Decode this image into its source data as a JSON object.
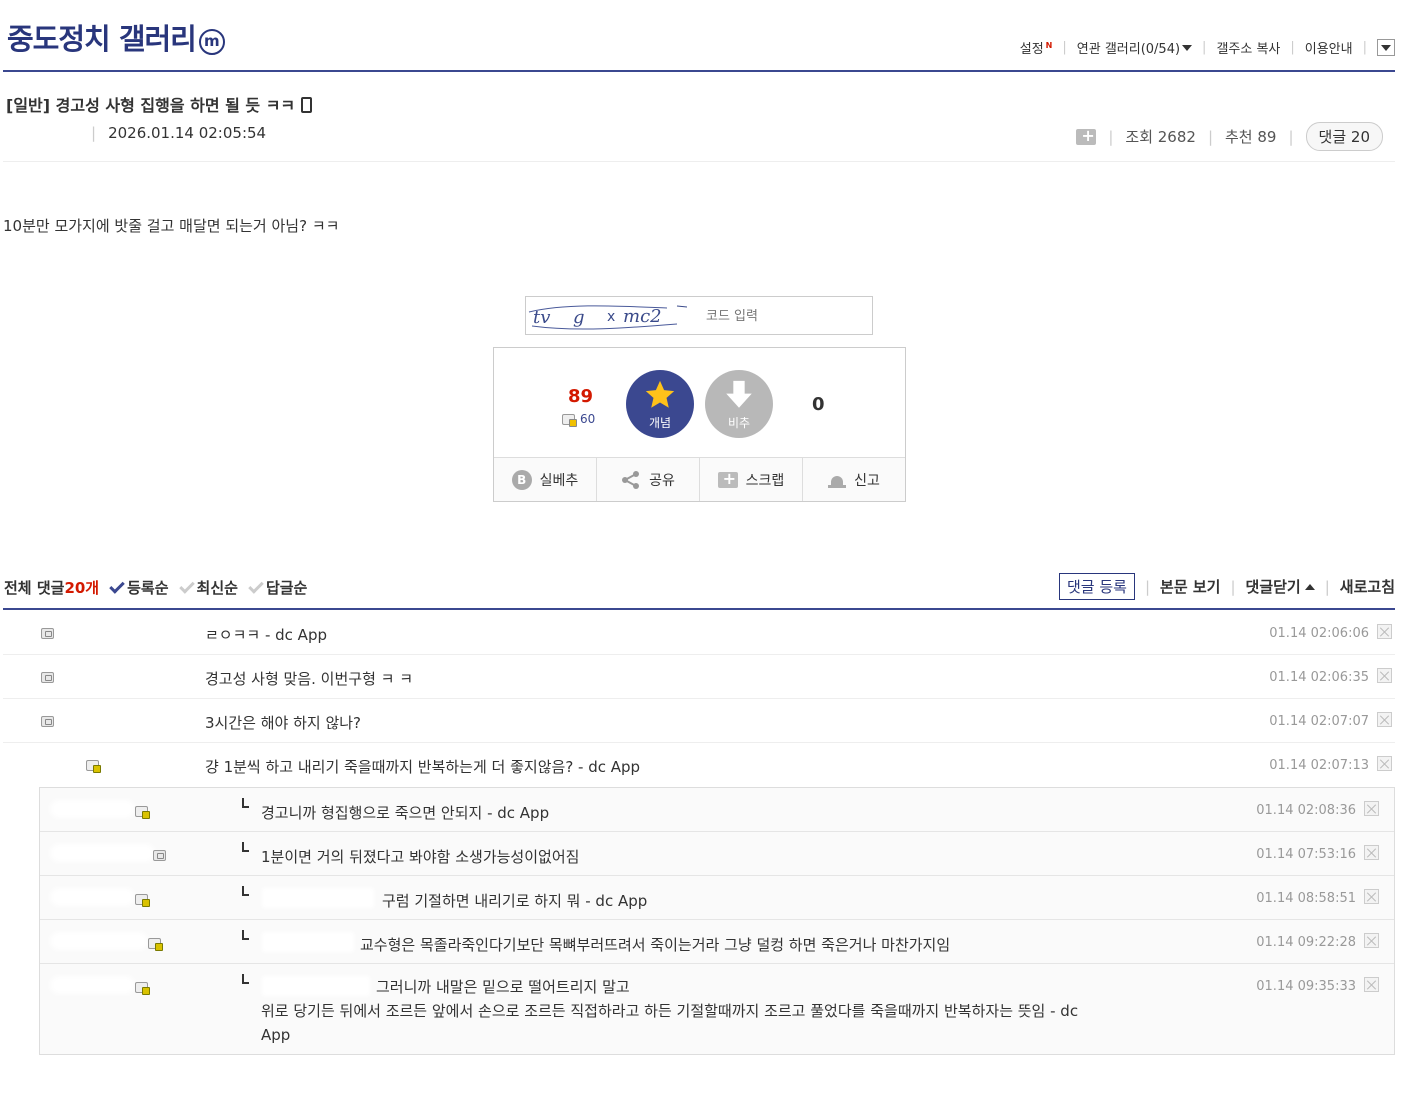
{
  "header": {
    "gallery_title": "중도정치 갤러리",
    "badge": "m",
    "menu": {
      "settings": "설정",
      "settings_new": "N",
      "related": "연관 갤러리(0/54)",
      "copy_addr": "갤주소 복사",
      "guide": "이용안내"
    }
  },
  "post": {
    "title": "[일반] 경고성 사형 집행을 하면 될 듯 ㅋㅋ",
    "date": "2026.01.14 02:05:54",
    "views_label": "조회 2682",
    "recommend_label": "추천 89",
    "comments_label": "댓글 20",
    "body": "10분만 모가지에 밧줄 걸고 매달면 되는거 아님? ㅋㅋ"
  },
  "captcha": {
    "placeholder": "코드 입력"
  },
  "vote": {
    "up_count": "89",
    "fixed_count": "60",
    "up_label": "개념",
    "down_label": "비추",
    "down_count": "0",
    "actions": {
      "best": "실베추",
      "share": "공유",
      "scrap": "스크랩",
      "report": "신고"
    }
  },
  "comments_bar": {
    "all_prefix": "전체 댓글 ",
    "count": "20개",
    "sort_reg": "등록순",
    "sort_new": "최신순",
    "sort_reply": "답글순",
    "register": "댓글 등록",
    "view_body": "본문 보기",
    "close": "댓글닫기",
    "refresh": "새로고침"
  },
  "comments": [
    {
      "text": "ㄹㅇㅋㅋ - dc App",
      "time": "01.14 02:06:06"
    },
    {
      "text": "경고성 사형 맞음. 이번구형 ㅋ ㅋ",
      "time": "01.14 02:06:35"
    },
    {
      "text": "3시간은 해야 하지 않나?",
      "time": "01.14 02:07:07"
    },
    {
      "text": "걍 1분씩 하고 내리기 죽을때까지 반복하는게 더 좋지않음? - dc App",
      "time": "01.14 02:07:13"
    }
  ],
  "replies": [
    {
      "text": "경고니까 형집행으로 죽으면 안되지 - dc App",
      "time": "01.14 02:08:36"
    },
    {
      "text": "1분이면 거의 뒤졌다고 봐야함 소생가능성이없어짐",
      "time": "01.14 07:53:16"
    },
    {
      "text": "구럼 기절하면 내리기로 하지 뭐 - dc App",
      "time": "01.14 08:58:51"
    },
    {
      "text": "교수형은 목졸라죽인다기보단 목뼈부러뜨려서 죽이는거라 그냥 덜컹 하면 죽은거나 마찬가지임",
      "time": "01.14 09:22:28"
    },
    {
      "line1": "그러니까 내말은 밑으로 떨어트리지 말고",
      "line2": "위로 당기든 뒤에서 조르든 앞에서 손으로 조르든 직접하라고 하든 기절할때까지 조르고 풀었다를 죽을때까지 반복하자는 뜻임 - dc",
      "line3": "App",
      "time": "01.14 09:35:33"
    }
  ]
}
